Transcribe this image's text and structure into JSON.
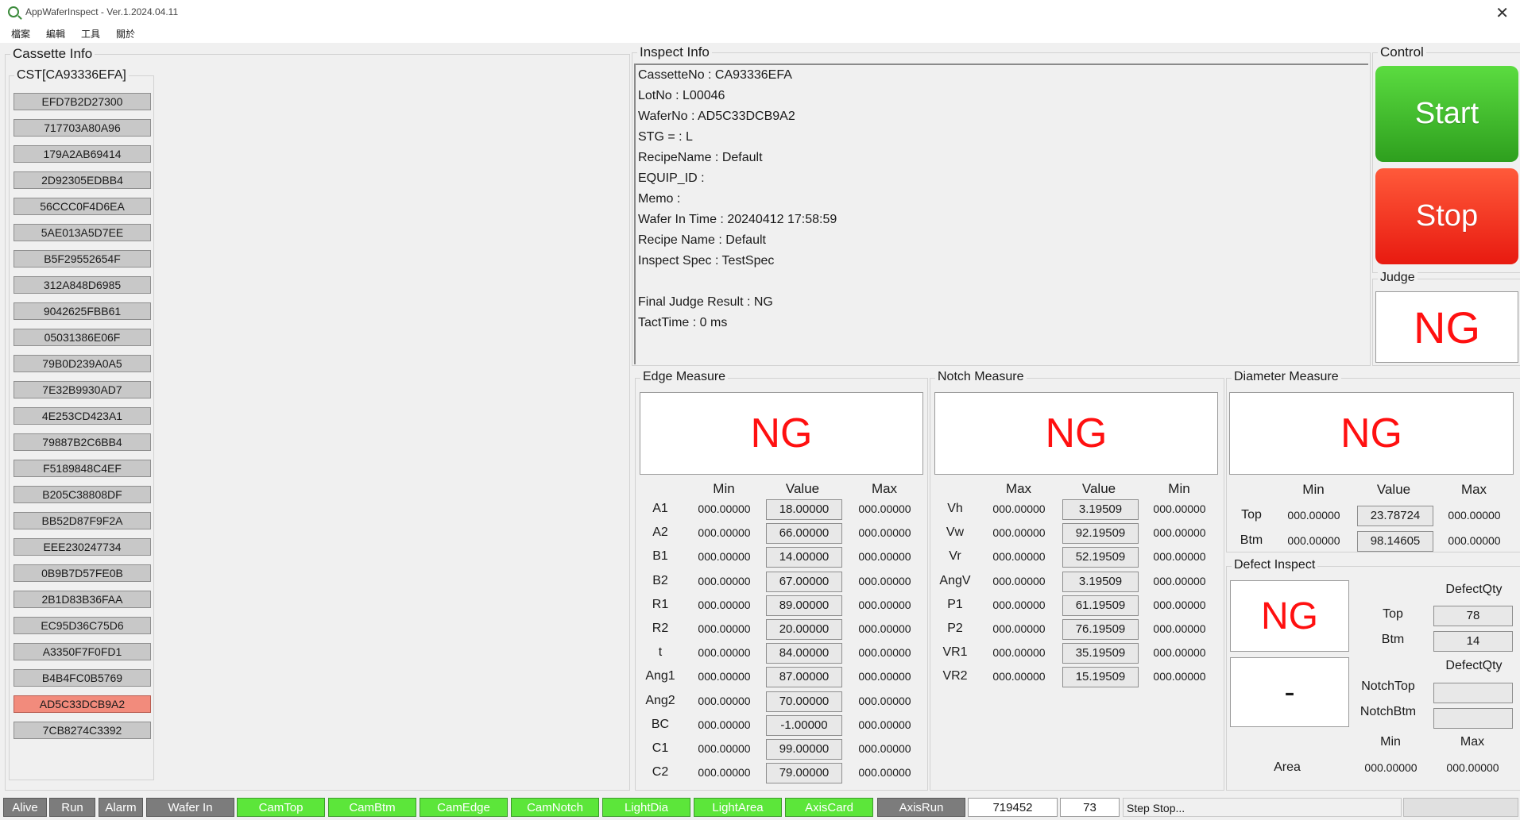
{
  "window": {
    "title": "AppWaferInspect - Ver.1.2024.04.11",
    "close": "✕"
  },
  "menu": [
    "檔案",
    "編輯",
    "工具",
    "關於"
  ],
  "cassette": {
    "title": "Cassette Info",
    "cst_label": "CST[CA93336EFA]",
    "wafers": [
      "EFD7B2D27300",
      "717703A80A96",
      "179A2AB69414",
      "2D92305EDBB4",
      "56CCC0F4D6EA",
      "5AE013A5D7EE",
      "B5F29552654F",
      "312A848D6985",
      "9042625FBB61",
      "05031386E06F",
      "79B0D239A0A5",
      "7E32B9930AD7",
      "4E253CD423A1",
      "79887B2C6BB4",
      "F5189848C4EF",
      "B205C38808DF",
      "BB52D87F9F2A",
      "EEE230247734",
      "0B9B7D57FE0B",
      "2B1D83B36FAA",
      "EC95D36C75D6",
      "A3350F7F0FD1",
      "B4B4FC0B5769",
      "AD5C33DCB9A2",
      "7CB8274C3392"
    ],
    "selected_index": 23
  },
  "inspect": {
    "title": "Inspect Info",
    "lines": [
      "CassetteNo  : CA93336EFA",
      "LotNo  : L00046",
      "WaferNo  : AD5C33DCB9A2",
      "STG =  : L",
      "RecipeName  : Default",
      "EQUIP_ID  :",
      "Memo  :",
      "Wafer In Time : 20240412 17:58:59",
      "Recipe Name : Default",
      "Inspect Spec : TestSpec",
      "",
      "Final Judge Result : NG",
      "TactTime : 0 ms"
    ]
  },
  "control": {
    "title": "Control",
    "start": "Start",
    "stop": "Stop",
    "judge_title": "Judge",
    "judge": "NG"
  },
  "edge": {
    "title": "Edge Measure",
    "judge": "NG",
    "headers": [
      "Min",
      "Value",
      "Max"
    ],
    "rows": [
      {
        "label": "A1",
        "min": "000.00000",
        "value": "18.00000",
        "max": "000.00000"
      },
      {
        "label": "A2",
        "min": "000.00000",
        "value": "66.00000",
        "max": "000.00000"
      },
      {
        "label": "B1",
        "min": "000.00000",
        "value": "14.00000",
        "max": "000.00000"
      },
      {
        "label": "B2",
        "min": "000.00000",
        "value": "67.00000",
        "max": "000.00000"
      },
      {
        "label": "R1",
        "min": "000.00000",
        "value": "89.00000",
        "max": "000.00000"
      },
      {
        "label": "R2",
        "min": "000.00000",
        "value": "20.00000",
        "max": "000.00000"
      },
      {
        "label": "t",
        "min": "000.00000",
        "value": "84.00000",
        "max": "000.00000"
      },
      {
        "label": "Ang1",
        "min": "000.00000",
        "value": "87.00000",
        "max": "000.00000"
      },
      {
        "label": "Ang2",
        "min": "000.00000",
        "value": "70.00000",
        "max": "000.00000"
      },
      {
        "label": "BC",
        "min": "000.00000",
        "value": "-1.00000",
        "max": "000.00000"
      },
      {
        "label": "C1",
        "min": "000.00000",
        "value": "99.00000",
        "max": "000.00000"
      },
      {
        "label": "C2",
        "min": "000.00000",
        "value": "79.00000",
        "max": "000.00000"
      }
    ]
  },
  "notch": {
    "title": "Notch Measure",
    "judge": "NG",
    "headers": [
      "Max",
      "Value",
      "Min"
    ],
    "rows": [
      {
        "label": "Vh",
        "a": "000.00000",
        "value": "3.19509",
        "b": "000.00000"
      },
      {
        "label": "Vw",
        "a": "000.00000",
        "value": "92.19509",
        "b": "000.00000"
      },
      {
        "label": "Vr",
        "a": "000.00000",
        "value": "52.19509",
        "b": "000.00000"
      },
      {
        "label": "AngV",
        "a": "000.00000",
        "value": "3.19509",
        "b": "000.00000"
      },
      {
        "label": "P1",
        "a": "000.00000",
        "value": "61.19509",
        "b": "000.00000"
      },
      {
        "label": "P2",
        "a": "000.00000",
        "value": "76.19509",
        "b": "000.00000"
      },
      {
        "label": "VR1",
        "a": "000.00000",
        "value": "35.19509",
        "b": "000.00000"
      },
      {
        "label": "VR2",
        "a": "000.00000",
        "value": "15.19509",
        "b": "000.00000"
      }
    ]
  },
  "diameter": {
    "title": "Diameter Measure",
    "judge": "NG",
    "headers": [
      "Min",
      "Value",
      "Max"
    ],
    "rows": [
      {
        "label": "Top",
        "min": "000.00000",
        "value": "23.78724",
        "max": "000.00000"
      },
      {
        "label": "Btm",
        "min": "000.00000",
        "value": "98.14605",
        "max": "000.00000"
      }
    ]
  },
  "defect": {
    "title": "Defect Inspect",
    "judge": "NG",
    "judge2": "-",
    "qty_header1": "DefectQty",
    "top_label": "Top",
    "top_value": "78",
    "btm_label": "Btm",
    "btm_value": "14",
    "qty_header2": "DefectQty",
    "notch_top_label": "NotchTop",
    "notch_top_value": "",
    "notch_btm_label": "NotchBtm",
    "notch_btm_value": "",
    "min_label": "Min",
    "max_label": "Max",
    "area_label": "Area",
    "area_min": "000.00000",
    "area_max": "000.00000"
  },
  "status": {
    "items": [
      {
        "label": "Alive",
        "state": "gray"
      },
      {
        "label": "Run",
        "state": "gray"
      },
      {
        "label": "Alarm",
        "state": "gray"
      },
      {
        "label": "Wafer In",
        "state": "gray"
      },
      {
        "label": "CamTop",
        "state": "green"
      },
      {
        "label": "CamBtm",
        "state": "green"
      },
      {
        "label": "CamEdge",
        "state": "green"
      },
      {
        "label": "CamNotch",
        "state": "green"
      },
      {
        "label": "LightDia",
        "state": "green"
      },
      {
        "label": "LightArea",
        "state": "green"
      },
      {
        "label": "AxisCard",
        "state": "green"
      },
      {
        "label": "AxisRun",
        "state": "gray"
      }
    ],
    "counter1": "719452",
    "counter2": "73",
    "message": "Step Stop...",
    "progress": 0
  }
}
